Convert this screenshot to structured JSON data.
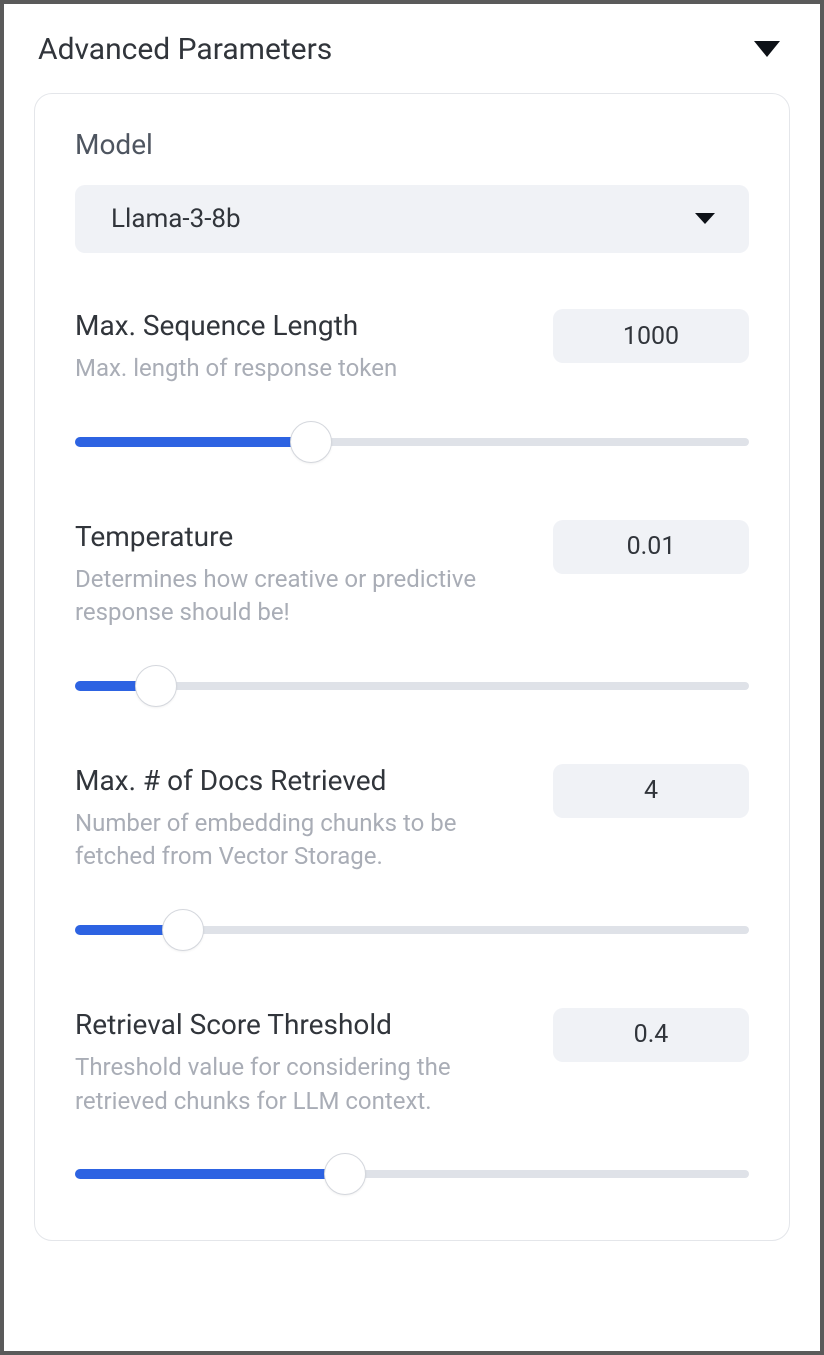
{
  "header": {
    "title": "Advanced Parameters"
  },
  "model": {
    "label": "Model",
    "selected": "Llama-3-8b"
  },
  "params": [
    {
      "title": "Max. Sequence Length",
      "desc": "Max. length of response token",
      "value": "1000",
      "percent": 35
    },
    {
      "title": "Temperature",
      "desc": "Determines how creative or predictive response should be!",
      "value": "0.01",
      "percent": 12
    },
    {
      "title": "Max. # of Docs Retrieved",
      "desc": "Number of embedding chunks to be fetched from Vector Storage.",
      "value": "4",
      "percent": 16
    },
    {
      "title": "Retrieval Score Threshold",
      "desc": "Threshold value for considering the retrieved chunks for LLM context.",
      "value": "0.4",
      "percent": 40
    }
  ]
}
